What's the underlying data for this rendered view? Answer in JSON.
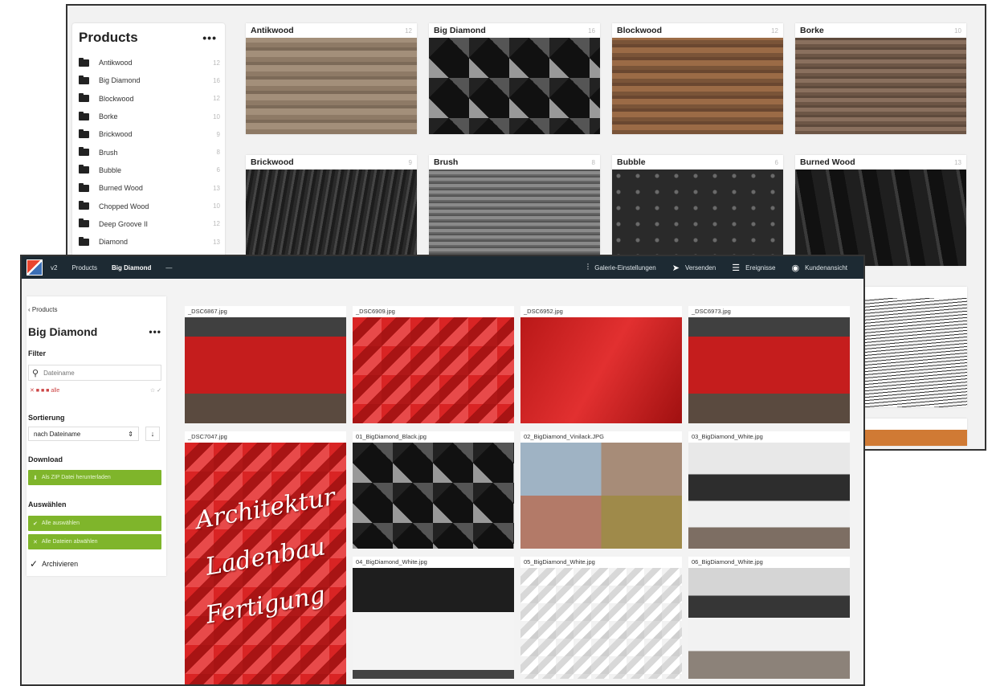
{
  "back_window": {
    "sidebar": {
      "title": "Products",
      "more": "•••",
      "items": [
        {
          "label": "Antikwood",
          "count": "12"
        },
        {
          "label": "Big Diamond",
          "count": "16"
        },
        {
          "label": "Blockwood",
          "count": "12"
        },
        {
          "label": "Borke",
          "count": "10"
        },
        {
          "label": "Brickwood",
          "count": "9"
        },
        {
          "label": "Brush",
          "count": "8"
        },
        {
          "label": "Bubble",
          "count": "6"
        },
        {
          "label": "Burned Wood",
          "count": "13"
        },
        {
          "label": "Chopped Wood",
          "count": "10"
        },
        {
          "label": "Deep Groove II",
          "count": "12"
        },
        {
          "label": "Diamond",
          "count": "13"
        }
      ]
    },
    "cards": [
      {
        "label": "Antikwood",
        "count": "12"
      },
      {
        "label": "Big Diamond",
        "count": "16"
      },
      {
        "label": "Blockwood",
        "count": "12"
      },
      {
        "label": "Borke",
        "count": "10"
      },
      {
        "label": "Brickwood",
        "count": "9"
      },
      {
        "label": "Brush",
        "count": "8"
      },
      {
        "label": "Bubble",
        "count": "6"
      },
      {
        "label": "Burned Wood",
        "count": "13"
      }
    ]
  },
  "front_window": {
    "topbar": {
      "crumbs": [
        "v2",
        "Products",
        "Big Diamond",
        "—"
      ],
      "buttons": [
        "Galerie-Einstellungen",
        "Versenden",
        "Ereignisse",
        "Kundenansicht"
      ]
    },
    "sidebar": {
      "back_link": "‹ Products",
      "title": "Big Diamond",
      "more": "•••",
      "filter_label": "Filter",
      "search_placeholder": "Dateiname",
      "tags": "✕ ■ ■ ■ alle",
      "tags_right": "☆ ✓",
      "sort_label": "Sortierung",
      "sort_value": "nach Dateiname",
      "sort_dir": "↓",
      "download_label": "Download",
      "download_button": "Als ZIP Datei herunterladen",
      "select_label": "Auswählen",
      "select_all_button": "Alle auswählen",
      "select_none_button": "Alle Dateien abwählen",
      "archive_label": "Archivieren"
    },
    "thumbnails": [
      {
        "name": "_DSC6867.jpg"
      },
      {
        "name": "_DSC6909.jpg"
      },
      {
        "name": "_DSC6952.jpg"
      },
      {
        "name": "_DSC6973.jpg"
      },
      {
        "name": "_DSC7047.jpg",
        "overlay": [
          "Architektur",
          "Ladenbau",
          "Fertigung"
        ]
      },
      {
        "name": "01_BigDiamond_Black.jpg"
      },
      {
        "name": "02_BigDiamond_Vinilack.JPG"
      },
      {
        "name": "03_BigDiamond_White.jpg"
      },
      {
        "name": "04_BigDiamond_White.jpg"
      },
      {
        "name": "05_BigDiamond_White.jpg"
      },
      {
        "name": "06_BigDiamond_White.jpg"
      }
    ]
  }
}
